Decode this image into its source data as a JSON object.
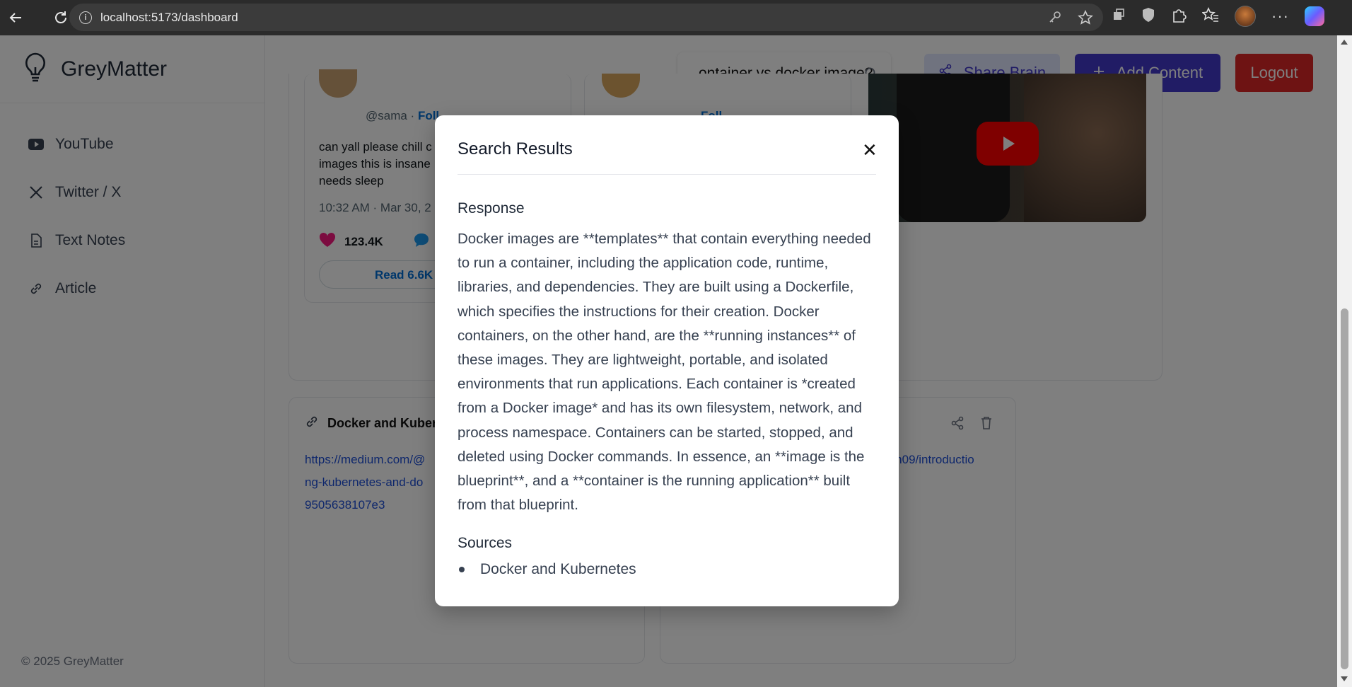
{
  "browser": {
    "url": "localhost:5173/dashboard"
  },
  "app": {
    "brand": "GreyMatter",
    "footer": "© 2025 GreyMatter"
  },
  "sidebar": {
    "items": [
      {
        "label": "YouTube",
        "icon": "youtube-icon"
      },
      {
        "label": "Twitter / X",
        "icon": "x-icon"
      },
      {
        "label": "Text Notes",
        "icon": "document-icon"
      },
      {
        "label": "Article",
        "icon": "link-icon"
      }
    ]
  },
  "topbar": {
    "search_value": "ontainer vs docker image?",
    "share_label": "Share Brain",
    "add_label": "Add Content",
    "logout_label": "Logout"
  },
  "background_cards": {
    "tweet": {
      "handle": "@sama · ",
      "follow": "Foll",
      "follow2": "Foll",
      "text1": "can yall please chill c",
      "text2": "images this is insane",
      "text3": "needs sleep",
      "time": "10:32 AM · Mar 30, 2",
      "likes": "123.4K",
      "read": "Read 6.6K r"
    },
    "article1": {
      "title": "Docker and Kuberne",
      "line1": "https://medium.com/@",
      "line2": "ng-kubernetes-and-do",
      "line3": "9505638107e3"
    },
    "article2": {
      "line1": "am09/introductio"
    }
  },
  "modal": {
    "title": "Search Results",
    "response_label": "Response",
    "response_text": "Docker images are **templates** that contain everything needed to run a container, including the application code, runtime, libraries, and dependencies. They are built using a Dockerfile, which specifies the instructions for their creation. Docker containers, on the other hand, are the **running instances** of these images. They are lightweight, portable, and isolated environments that run applications. Each container is *created from a Docker image* and has its own filesystem, network, and process namespace. Containers can be started, stopped, and deleted using Docker commands. In essence, an **image is the blueprint**, and a **container is the running application** built from that blueprint.",
    "sources_label": "Sources",
    "sources": [
      "Docker and Kubernetes"
    ]
  },
  "colors": {
    "primary": "#4338ca",
    "primary_light": "#e0e7ff",
    "danger": "#dc2626"
  }
}
